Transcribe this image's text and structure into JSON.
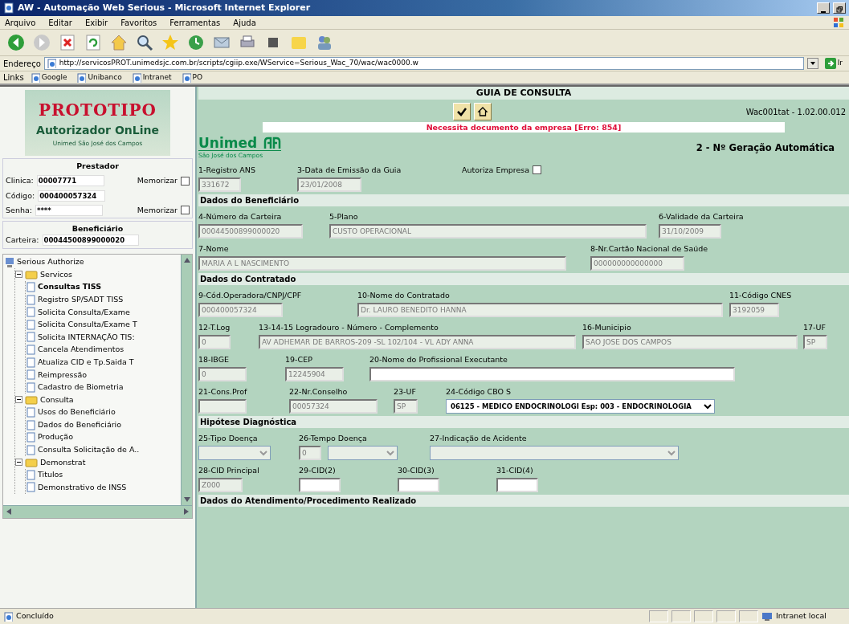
{
  "window": {
    "title": "AW - Automação Web Serious - Microsoft Internet Explorer"
  },
  "menu": [
    "Arquivo",
    "Editar",
    "Exibir",
    "Favoritos",
    "Ferramentas",
    "Ajuda"
  ],
  "address": {
    "label": "Endereço",
    "url": "http://servicosPROT.unimedsjc.com.br/scripts/cgiip.exe/WService=Serious_Wac_70/wac/wac0000.w",
    "go": "Ir"
  },
  "links": {
    "label": "Links",
    "items": [
      "Google",
      "Unibanco",
      "Intranet",
      "PO"
    ]
  },
  "sidebar": {
    "logo": {
      "title": "PROTOTIPO",
      "subtitle": "Autorizador OnLine",
      "caption": "Unimed São José dos Campos"
    },
    "provider": {
      "title": "Prestador",
      "fields": [
        {
          "label": "Clinica:",
          "value": "00007771",
          "remember": "Memorizar",
          "checked": false
        },
        {
          "label": "Código:",
          "value": "000400057324"
        },
        {
          "label": "Senha:",
          "value": "****",
          "remember": "Memorizar",
          "checked": false
        }
      ]
    },
    "beneficiary": {
      "title": "Beneficiário",
      "label": "Carteira:",
      "value": "00044500899000020"
    },
    "tree": {
      "kind": "root",
      "label": "Serious Authorize",
      "selected": false,
      "children": [
        {
          "kind": "folder",
          "label": "Servicos",
          "expanded": true,
          "selected": false,
          "children": [
            {
              "kind": "page",
              "label": "Consultas TISS",
              "selected": true
            },
            {
              "kind": "page",
              "label": "Registro SP/SADT TISS",
              "selected": false
            },
            {
              "kind": "page",
              "label": "Solicita Consulta/Exame",
              "selected": false
            },
            {
              "kind": "page",
              "label": "Solicita Consulta/Exame T",
              "selected": false
            },
            {
              "kind": "page",
              "label": "Solicita INTERNAÇÃO TIS:",
              "selected": false
            },
            {
              "kind": "page",
              "label": "Cancela Atendimentos",
              "selected": false
            },
            {
              "kind": "page",
              "label": "Atualiza CID e Tp.Saida T",
              "selected": false
            },
            {
              "kind": "page",
              "label": "Reimpressão",
              "selected": false
            },
            {
              "kind": "page",
              "label": "Cadastro de Biometria",
              "selected": false
            }
          ]
        },
        {
          "kind": "folder",
          "label": "Consulta",
          "expanded": true,
          "selected": false,
          "children": [
            {
              "kind": "page",
              "label": "Usos do Beneficiário",
              "selected": false
            },
            {
              "kind": "page",
              "label": "Dados do Beneficiário",
              "selected": false
            },
            {
              "kind": "page",
              "label": "Produção",
              "selected": false
            },
            {
              "kind": "page",
              "label": "Consulta Solicitação de A..",
              "selected": false
            }
          ]
        },
        {
          "kind": "folder",
          "label": "Demonstrat",
          "expanded": true,
          "selected": false,
          "children": [
            {
              "kind": "page",
              "label": "Titulos",
              "selected": false
            },
            {
              "kind": "page",
              "label": "Demonstrativo de INSS",
              "selected": false
            }
          ]
        }
      ]
    }
  },
  "main": {
    "title": "GUIA DE CONSULTA",
    "version": "Wac001tat - 1.02.00.012",
    "error": "Necessita documento da empresa [Erro: 854]",
    "logo": {
      "name": "Unimed",
      "city": "São José dos Campos"
    },
    "guide_number": "2 - Nº Geração Automática",
    "form": [
      {
        "kind": "row",
        "fields": [
          {
            "kind": "text",
            "label": "1-Registro ANS",
            "value": "331672",
            "disabled": true
          },
          {
            "kind": "text",
            "label": "3-Data de Emissão da Guia",
            "value": "23/01/2008",
            "disabled": true
          },
          {
            "kind": "checkbox",
            "label": "Autoriza Empresa",
            "checked": false
          }
        ]
      },
      {
        "kind": "section",
        "title": "Dados do Beneficiário"
      },
      {
        "kind": "row",
        "fields": [
          {
            "kind": "text",
            "label": "4-Número da Carteira",
            "value": "00044500899000020",
            "disabled": true
          },
          {
            "kind": "text",
            "label": "5-Plano",
            "value": "CUSTO OPERACIONAL",
            "disabled": true
          },
          {
            "kind": "text",
            "label": "6-Validade da Carteira",
            "value": "31/10/2009",
            "disabled": true
          }
        ]
      },
      {
        "kind": "row",
        "fields": [
          {
            "kind": "text",
            "label": "7-Nome",
            "value": "MARIA A L NASCIMENTO",
            "disabled": true
          },
          {
            "kind": "text",
            "label": "8-Nr.Cartão Nacional de Saúde",
            "value": "000000000000000",
            "disabled": true
          }
        ]
      },
      {
        "kind": "section",
        "title": "Dados do Contratado"
      },
      {
        "kind": "row",
        "fields": [
          {
            "kind": "text",
            "label": "9-Cód.Operadora/CNPJ/CPF",
            "value": "000400057324",
            "disabled": true
          },
          {
            "kind": "text",
            "label": "10-Nome do Contratado",
            "value": "Dr. LAURO BENEDITO HANNA",
            "disabled": true
          },
          {
            "kind": "text",
            "label": "11-Código CNES",
            "value": "3192059",
            "disabled": true
          }
        ]
      },
      {
        "kind": "row",
        "fields": [
          {
            "kind": "text",
            "label": "12-T.Log",
            "value": "0",
            "disabled": true
          },
          {
            "kind": "text",
            "label": "13-14-15 Logradouro - Número - Complemento",
            "value": "AV ADHEMAR DE BARROS-209 -SL 102/104 - VL ADY ANNA",
            "disabled": true
          },
          {
            "kind": "text",
            "label": "16-Municipio",
            "value": "SAO JOSE DOS CAMPOS",
            "disabled": true
          },
          {
            "kind": "text",
            "label": "17-UF",
            "value": "SP",
            "disabled": true
          }
        ]
      },
      {
        "kind": "row",
        "fields": [
          {
            "kind": "text",
            "label": "18-IBGE",
            "value": "0",
            "disabled": true
          },
          {
            "kind": "text",
            "label": "19-CEP",
            "value": "12245904",
            "disabled": true
          },
          {
            "kind": "text",
            "label": "20-Nome do Profissional Executante",
            "disabled": false
          }
        ]
      },
      {
        "kind": "row",
        "fields": [
          {
            "kind": "text",
            "label": "21-Cons.Prof",
            "disabled": true
          },
          {
            "kind": "text",
            "label": "22-Nr.Conselho",
            "value": "00057324",
            "disabled": true
          },
          {
            "kind": "text",
            "label": "23-UF",
            "value": "SP",
            "disabled": true
          },
          {
            "kind": "select",
            "label": "24-Código CBO S",
            "value": "06125 - MEDICO ENDOCRINOLOGI Esp: 003 - ENDOCRINOLOGIA",
            "disabled": false
          }
        ]
      },
      {
        "kind": "section",
        "title": "Hipótese Diagnóstica"
      },
      {
        "kind": "row",
        "fields": [
          {
            "kind": "select",
            "label": "25-Tipo Doença",
            "disabled": true
          },
          {
            "kind": "combo",
            "label": "26-Tempo Doença",
            "value": "0",
            "disabled": true
          },
          {
            "kind": "select",
            "label": "27-Indicação de Acidente",
            "disabled": true
          }
        ]
      },
      {
        "kind": "row",
        "fields": [
          {
            "kind": "text",
            "label": "28-CID Principal",
            "value": "Z000",
            "disabled": true
          },
          {
            "kind": "text",
            "label": "29-CID(2)",
            "disabled": false
          },
          {
            "kind": "text",
            "label": "30-CID(3)",
            "disabled": false
          },
          {
            "kind": "text",
            "label": "31-CID(4)",
            "disabled": false
          }
        ]
      },
      {
        "kind": "section",
        "title": "Dados do Atendimento/Procedimento Realizado"
      }
    ]
  },
  "status_bar": {
    "text": "Concluído",
    "zone": "Intranet local"
  }
}
